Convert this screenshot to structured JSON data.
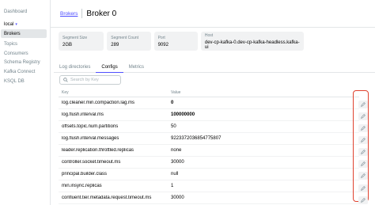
{
  "sidebar": {
    "dashboard_label": "Dashboard",
    "cluster_name": "local",
    "items": [
      {
        "label": "Brokers",
        "active": true
      },
      {
        "label": "Topics",
        "active": false
      },
      {
        "label": "Consumers",
        "active": false
      },
      {
        "label": "Schema Registry",
        "active": false
      },
      {
        "label": "Kafka Connect",
        "active": false
      },
      {
        "label": "KSQL DB",
        "active": false
      }
    ]
  },
  "header": {
    "breadcrumb": "Brokers",
    "title": "Broker 0"
  },
  "stats": [
    {
      "label": "Segment Size",
      "value": "2GB"
    },
    {
      "label": "Segment Count",
      "value": "289"
    },
    {
      "label": "Port",
      "value": "9092"
    },
    {
      "label": "Host",
      "value": "dev-cp-kafka-0.dev-cp-kafka-headless.kafka-ui"
    }
  ],
  "tabs": [
    {
      "label": "Log directories",
      "active": false
    },
    {
      "label": "Configs",
      "active": true
    },
    {
      "label": "Metrics",
      "active": false
    }
  ],
  "search": {
    "placeholder": "Search by Key",
    "value": ""
  },
  "table": {
    "columns": [
      "Key",
      "Value"
    ],
    "rows": [
      {
        "key": "log.cleaner.min.compaction.lag.ms",
        "value": "0",
        "bold": true
      },
      {
        "key": "log.flush.interval.ms",
        "value": "100000000",
        "bold": true
      },
      {
        "key": "offsets.topic.num.partitions",
        "value": "50",
        "bold": false
      },
      {
        "key": "log.flush.interval.messages",
        "value": "9223372036854775807",
        "bold": false
      },
      {
        "key": "leader.replication.throttled.replicas",
        "value": "none",
        "bold": false
      },
      {
        "key": "controller.socket.timeout.ms",
        "value": "30000",
        "bold": false
      },
      {
        "key": "principal.builder.class",
        "value": "null",
        "bold": false
      },
      {
        "key": "min.insync.replicas",
        "value": "1",
        "bold": false
      },
      {
        "key": "confluent.tier.metadata.request.timeout.ms",
        "value": "30000",
        "bold": false
      }
    ]
  },
  "colors": {
    "accent": "#4f4fff",
    "highlight": "#e0422f"
  }
}
